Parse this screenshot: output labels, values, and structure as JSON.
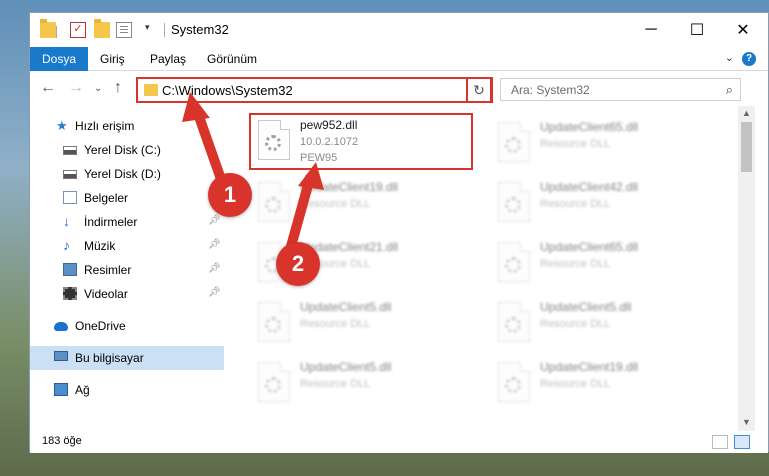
{
  "window": {
    "title": "System32"
  },
  "ribbon": {
    "tabs": [
      {
        "label": "Dosya"
      },
      {
        "label": "Giriş"
      },
      {
        "label": "Paylaş"
      },
      {
        "label": "Görünüm"
      }
    ]
  },
  "navbar": {
    "address": "C:\\Windows\\System32",
    "search_placeholder": "Ara: System32"
  },
  "sidebar": {
    "items": [
      {
        "label": "Hızlı erişim",
        "icon": "star-icon"
      },
      {
        "label": "Yerel Disk (C:)",
        "icon": "drive-icon"
      },
      {
        "label": "Yerel Disk (D:)",
        "icon": "drive-icon"
      },
      {
        "label": "Belgeler",
        "icon": "documents-icon"
      },
      {
        "label": "İndirmeler",
        "icon": "download-icon"
      },
      {
        "label": "Müzik",
        "icon": "music-icon"
      },
      {
        "label": "Resimler",
        "icon": "pictures-icon"
      },
      {
        "label": "Videolar",
        "icon": "video-icon"
      },
      {
        "label": "OneDrive",
        "icon": "cloud-icon"
      },
      {
        "label": "Bu bilgisayar",
        "icon": "computer-icon"
      },
      {
        "label": "Ağ",
        "icon": "network-icon"
      }
    ]
  },
  "files": [
    {
      "name": "pew952.dll",
      "desc": "10.0.2.1072",
      "extra": "PEW95"
    },
    {
      "name": "UpdateClient65.dll",
      "desc": "Resource DLL"
    },
    {
      "name": "UpdateClient19.dll",
      "desc": "Resource DLL"
    },
    {
      "name": "UpdateClient42.dll",
      "desc": "Resource DLL"
    },
    {
      "name": "UpdateClient21.dll",
      "desc": "Resource DLL"
    },
    {
      "name": "UpdateClient65.dll",
      "desc": "Resource DLL"
    },
    {
      "name": "UpdateClient5.dll",
      "desc": "Resource DLL"
    },
    {
      "name": "UpdateClient5.dll",
      "desc": "Resource DLL"
    },
    {
      "name": "UpdateClient5.dll",
      "desc": "Resource DLL"
    },
    {
      "name": "UpdateClient19.dll",
      "desc": "Resource DLL"
    }
  ],
  "status": {
    "item_count": "183 öğe"
  },
  "annotations": {
    "callout_1": "1",
    "callout_2": "2",
    "accent": "#d9342b"
  },
  "colors": {
    "ribbon_active": "#1979ca",
    "sidebar_selected": "#cce0f5"
  }
}
